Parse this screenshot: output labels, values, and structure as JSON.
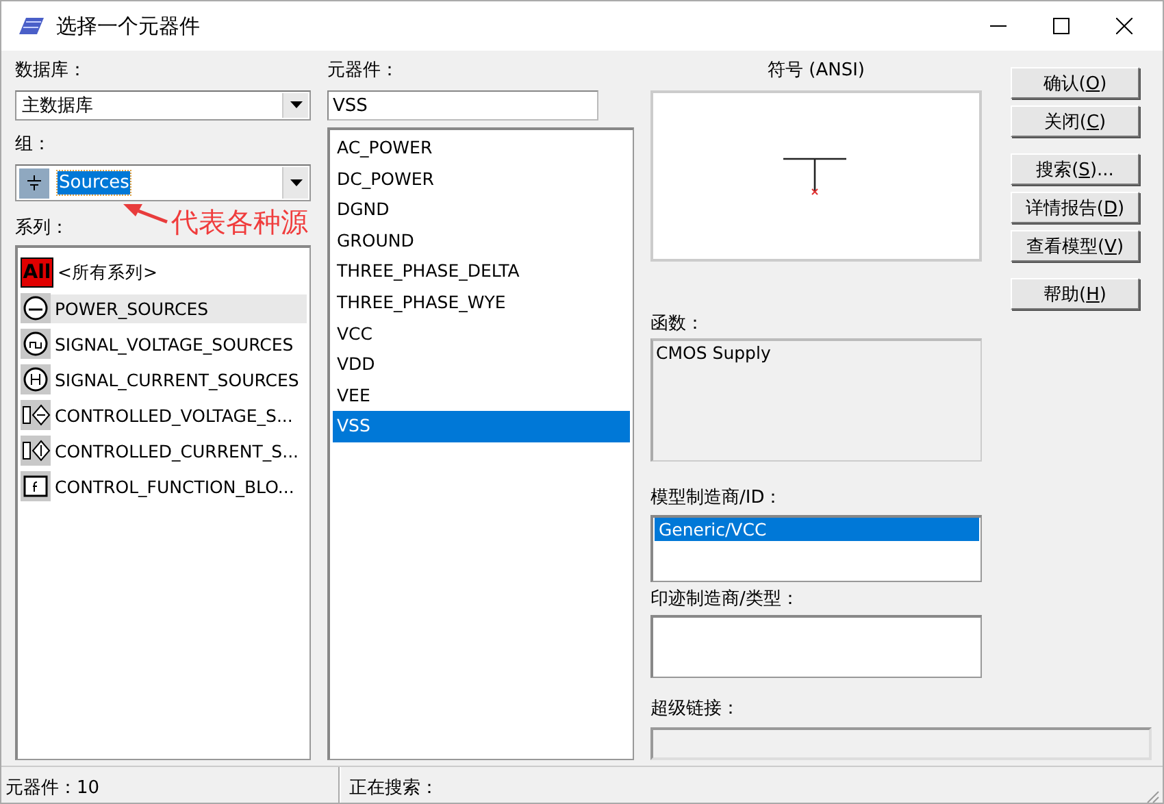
{
  "window": {
    "title": "选择一个元器件"
  },
  "database": {
    "label": "数据库：",
    "value": "主数据库"
  },
  "group": {
    "label": "组：",
    "value": "Sources",
    "selected": true
  },
  "series": {
    "label": "系列：",
    "items": [
      {
        "kind": "all",
        "badge": "All",
        "label": "<所有系列>",
        "selected": false
      },
      {
        "kind": "power",
        "label": "POWER_SOURCES",
        "selected": true
      },
      {
        "kind": "signal-voltage",
        "label": "SIGNAL_VOLTAGE_SOURCES",
        "selected": false
      },
      {
        "kind": "signal-current",
        "label": "SIGNAL_CURRENT_SOURCES",
        "selected": false
      },
      {
        "kind": "controlled-voltage",
        "label": "CONTROLLED_VOLTAGE_S...",
        "selected": false
      },
      {
        "kind": "controlled-current",
        "label": "CONTROLLED_CURRENT_S...",
        "selected": false
      },
      {
        "kind": "function",
        "label": "CONTROL_FUNCTION_BLO...",
        "selected": false
      }
    ]
  },
  "components": {
    "label": "元器件：",
    "value": "VSS",
    "items": [
      {
        "label": "AC_POWER",
        "selected": false
      },
      {
        "label": "DC_POWER",
        "selected": false
      },
      {
        "label": "DGND",
        "selected": false
      },
      {
        "label": "GROUND",
        "selected": false
      },
      {
        "label": "THREE_PHASE_DELTA",
        "selected": false
      },
      {
        "label": "THREE_PHASE_WYE",
        "selected": false
      },
      {
        "label": "VCC",
        "selected": false
      },
      {
        "label": "VDD",
        "selected": false
      },
      {
        "label": "VEE",
        "selected": false
      },
      {
        "label": "VSS",
        "selected": true
      }
    ]
  },
  "symbol": {
    "label": "符号 (ANSI)"
  },
  "function": {
    "label": "函数：",
    "value": "CMOS Supply"
  },
  "model": {
    "label": "模型制造商/ID：",
    "items": [
      {
        "label": "Generic/VCC",
        "selected": true
      }
    ]
  },
  "footprint": {
    "label": "印迹制造商/类型："
  },
  "hyperlink": {
    "label": "超级链接："
  },
  "buttons": [
    [
      {
        "prefix": "确认(",
        "key": "O",
        "suffix": ")"
      },
      {
        "prefix": "关闭(",
        "key": "C",
        "suffix": ")"
      }
    ],
    [
      {
        "prefix": "搜索(",
        "key": "S",
        "suffix": ")..."
      },
      {
        "prefix": "详情报告(",
        "key": "D",
        "suffix": ")"
      },
      {
        "prefix": "查看模型(",
        "key": "V",
        "suffix": ")"
      }
    ],
    [
      {
        "prefix": "帮助(",
        "key": "H",
        "suffix": ")"
      }
    ]
  ],
  "annotation": {
    "text": "代表各种源"
  },
  "status_bar": {
    "count": "元器件：10",
    "search": "正在搜索："
  }
}
